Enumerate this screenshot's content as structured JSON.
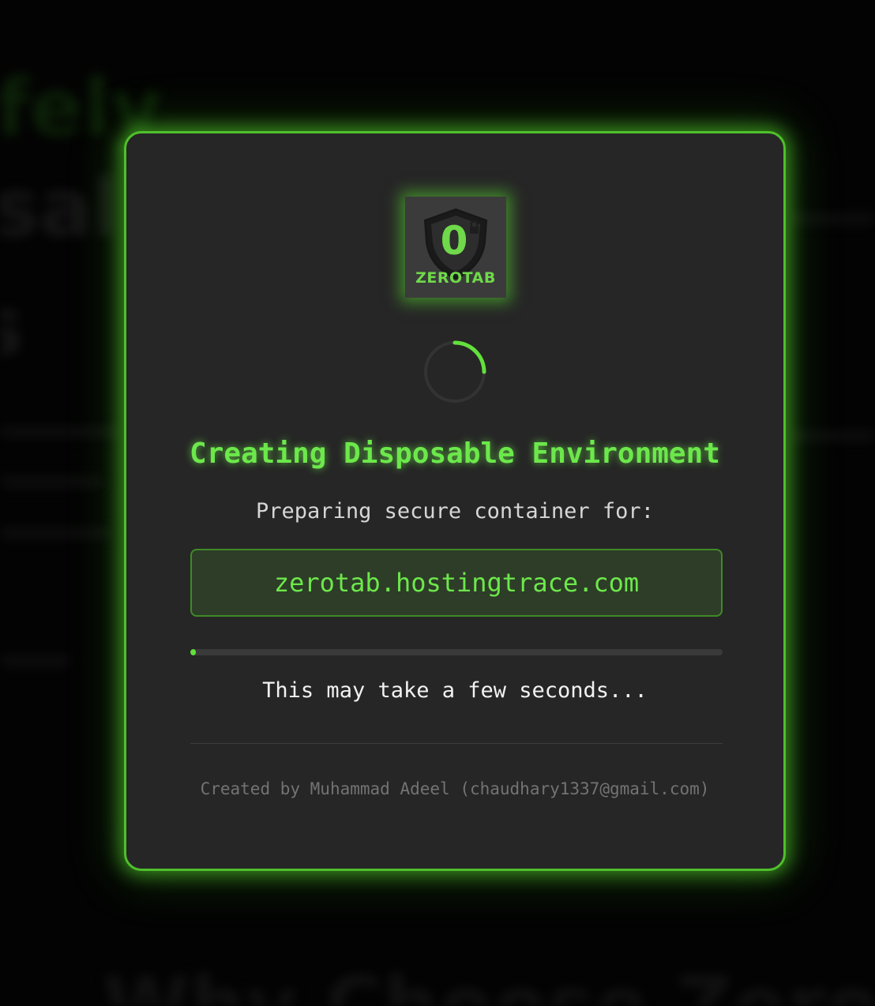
{
  "background": {
    "headline_partial_1": "fely",
    "headline_partial_2": "sal",
    "headline_partial_3": "s",
    "bottom_heading_partial": "Why Choose ZeroTab"
  },
  "modal": {
    "logo": {
      "mark": "0",
      "label": "ZEROTAB",
      "icon": "shield-lock-icon"
    },
    "spinner": {
      "icon": "loading-spinner-icon"
    },
    "title": "Creating Disposable Environment",
    "subtitle": "Preparing secure container for:",
    "target_url": "zerotab.hostingtrace.com",
    "progress": 0.01,
    "hint": "This may take a few seconds...",
    "credit": "Created by Muhammad Adeel (chaudhary1337@gmail.com)"
  },
  "colors": {
    "accent": "#6ce84b",
    "border": "#4fbf2c",
    "panel": "#262626",
    "backdrop": "#050505"
  }
}
